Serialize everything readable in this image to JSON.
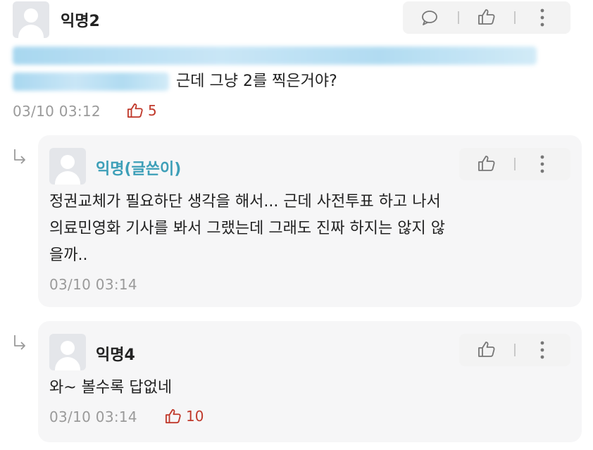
{
  "comment": {
    "author": "익명2",
    "text": "근데 그냥 2를 찍은거야?",
    "timestamp": "03/10 03:12",
    "likes": "5",
    "icons": [
      "comment-icon",
      "thumbs-up-icon",
      "more-icon"
    ]
  },
  "replies": [
    {
      "author": "익명(글쓴이)",
      "text_lines": [
        "정권교체가 필요하단 생각을 해서... 근데 사전투표 하고 나서",
        "의료민영화 기사를 봐서 그랬는데 그래도 진짜 하지는 않지 않",
        "을까.."
      ],
      "timestamp": "03/10 03:14"
    },
    {
      "author": "익명4",
      "text": "와~ 볼수록 답없네",
      "timestamp": "03/10 03:14",
      "likes": "10"
    }
  ],
  "colors": {
    "op_author": "#3d9fb8",
    "like": "#c0392b",
    "meta": "#9a9a9a"
  }
}
